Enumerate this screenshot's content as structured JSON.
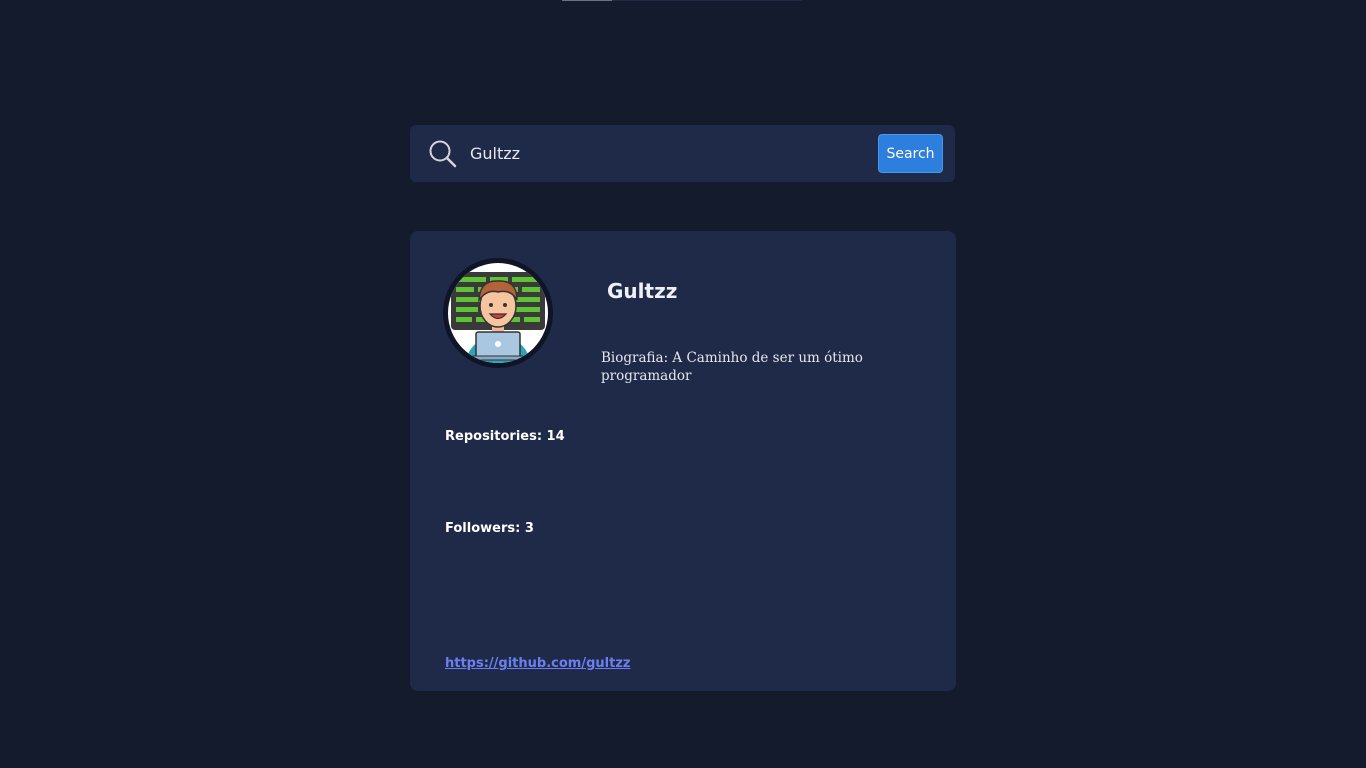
{
  "search": {
    "value": "Gultzz",
    "button_label": "Search"
  },
  "profile": {
    "name": "Gultzz",
    "bio_label": "Biografia:",
    "bio_text": "A Caminho de ser um ótimo programador",
    "bio_full": "Biografia: A Caminho de ser um ótimo programador",
    "repositories_full": "Repositories: 14",
    "followers_full": "Followers: 3",
    "link": "https://github.com/gultzz"
  },
  "icons": {
    "search": "search-icon",
    "avatar": "avatar"
  },
  "colors": {
    "background": "#141b2d",
    "card": "#1f2a48",
    "accent": "#2d7fdd",
    "link": "#6c7ff0"
  }
}
